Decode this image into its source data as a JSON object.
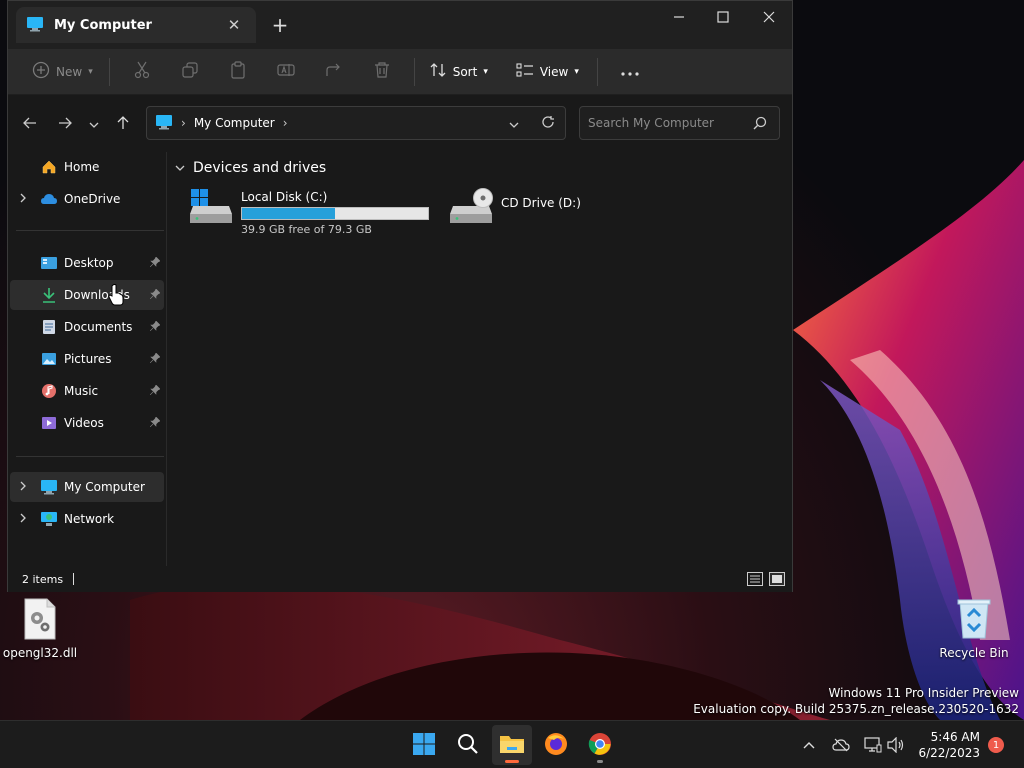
{
  "window": {
    "tab_title": "My Computer",
    "toolbar": {
      "new_label": "New",
      "sort_label": "Sort",
      "view_label": "View"
    },
    "address": {
      "crumb": "My Computer"
    },
    "search": {
      "placeholder": "Search My Computer"
    },
    "sidebar": {
      "items": [
        {
          "label": "Home"
        },
        {
          "label": "OneDrive"
        },
        {
          "label": "Desktop"
        },
        {
          "label": "Downloads"
        },
        {
          "label": "Documents"
        },
        {
          "label": "Pictures"
        },
        {
          "label": "Music"
        },
        {
          "label": "Videos"
        },
        {
          "label": "My Computer"
        },
        {
          "label": "Network"
        }
      ]
    },
    "content": {
      "group_title": "Devices and drives",
      "drives": [
        {
          "name": "Local Disk (C:)",
          "free_text": "39.9 GB free of 79.3 GB",
          "used_fraction": 0.5
        },
        {
          "name": "CD Drive (D:)"
        }
      ]
    },
    "status": {
      "items_text": "2 items"
    }
  },
  "desktop": {
    "icons": [
      {
        "label": "opengl32.dll"
      },
      {
        "label": "Recycle Bin"
      }
    ],
    "watermark": {
      "line1": "Windows 11 Pro Insider Preview",
      "line2": "Evaluation copy. Build 25375.zn_release.230520-1632"
    }
  },
  "taskbar": {
    "time": "5:46 AM",
    "date": "6/22/2023",
    "notification_count": "1"
  },
  "colors": {
    "accent": "#26a0da",
    "window_bg": "#191919",
    "toolbar_bg": "#2b2b2b",
    "notification": "#ef5b4c"
  }
}
